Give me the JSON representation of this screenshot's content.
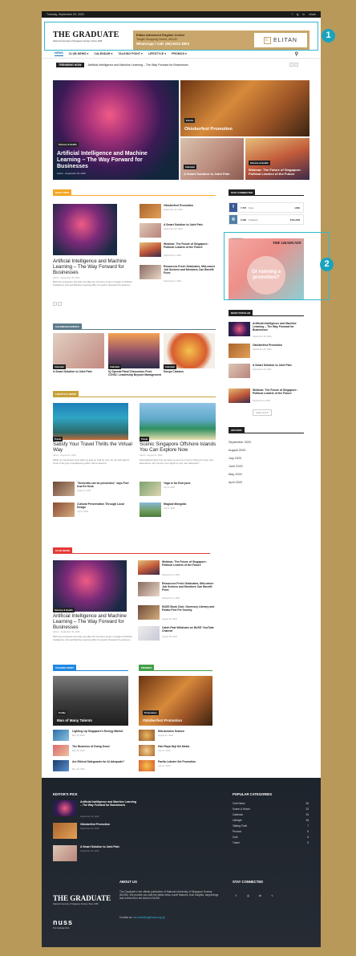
{
  "topbar": {
    "date": "Tuesday, September 29, 2020",
    "social": [
      "f",
      "ig",
      "in",
      "share"
    ]
  },
  "logo": {
    "title": "THE GRADUATE",
    "subtitle": "National University of Singapore Society  |  Since 1965"
  },
  "ad": {
    "line1": "Elitan Advanced English Centre",
    "line2": "Tanglin Shopping Centre, #04-82",
    "line3": "WhatsApp / Call: (65) 8223 3903",
    "brand": "ELITAN",
    "brand_sub": "E"
  },
  "badges": {
    "one": "1",
    "two": "2"
  },
  "nav": {
    "items": [
      "NEWS",
      "CLUB NEWS ▾",
      "CALENDAR ▾",
      "TALKING POINT ▾",
      "LIFESTYLE ▾",
      "PROMOS ▾"
    ]
  },
  "trending": {
    "label": "TRENDING NOW",
    "text": "Artificial Intelligence and Machine Learning – The Way Forward for Businesses"
  },
  "hero": {
    "big": {
      "tags": "Science & Health",
      "title": "Artificial Intelligence and Machine Learning – The Way Forward for Businesses",
      "meta": "Admin  -  September 30, 2020"
    },
    "top": {
      "tag": "Events",
      "title": "Oktoberfest Promotion"
    },
    "bl": {
      "tag": "Calendar",
      "title": "A Smart Solution to Joint Pain"
    },
    "br": {
      "tag": "Science & Health",
      "title": "Webinar: The Future of Singapore: Political Leaders of the Future"
    }
  },
  "dont_miss": {
    "label": "DON'T MISS",
    "main": {
      "title": "Artificial Intelligence and Machine Learning – The Way Forward for Businesses",
      "meta": "Admin  -  September 30, 2020",
      "text": "Both big companies and start-ups alike are immense scope of usage of Artificial Intelligence (AI) and Machine Learning (ML) for growth. Research by advisory..."
    },
    "list": [
      {
        "title": "Oktoberfest Promotion",
        "date": "September 29, 2020"
      },
      {
        "title": "A Smart Solution to Joint Pain",
        "date": "September 22, 2020"
      },
      {
        "title": "Webinar: The Future of Singapore: Political Leaders of the Future",
        "date": "September 9, 2020"
      },
      {
        "title": "Resources Fresh Graduates, Mid-career Job Seekers and Members Can Benefit From",
        "date": "September 3, 2020"
      }
    ]
  },
  "stay": {
    "label": "STAY CONNECTED",
    "fb": {
      "n": "7,797",
      "l": "Fans",
      "a": "LIKE"
    },
    "ig": {
      "n": "1,000",
      "l": "Followers",
      "a": "FOLLOW"
    }
  },
  "sidead": {
    "label": "Advertisement",
    "logo": "THE GRADUATE",
    "text": "Or running a promotion?"
  },
  "calendar": {
    "label": "CALENDAR EVENTS",
    "items": [
      {
        "tag": "Calendar",
        "title": "A Smart Solution to Joint Pain"
      },
      {
        "tag": "Calendar",
        "title": "IQ Special Panel Discussion Post-COVID: Leadership Beyond Management"
      },
      {
        "tag": "Calendar",
        "title": "Nonya Classics"
      }
    ]
  },
  "popular": {
    "label": "MOST POPULAR",
    "items": [
      {
        "title": "Artificial Intelligence and Machine Learning – The Way Forward for Businesses",
        "date": "September 30, 2020"
      },
      {
        "title": "Oktoberfest Promotion",
        "date": "September 29, 2020"
      },
      {
        "title": "A Smart Solution to Joint Pain",
        "date": "September 22, 2020"
      },
      {
        "title": "Webinar: The Future of Singapore: Political Leaders of the Future",
        "date": "September 9, 2020"
      }
    ],
    "load": "Load more ▾"
  },
  "archive": {
    "label": "ARCHIVE",
    "items": [
      "September 2020",
      "August 2020",
      "July 2020",
      "June 2020",
      "May 2020",
      "April 2020"
    ]
  },
  "lifestyle": {
    "label": "LIFESTYLE NEWS",
    "a": {
      "tag": "Travel",
      "title": "Satisfy Your Travel Thrills the Virtual Way",
      "meta": "Admin  -  August 24, 2020",
      "text": "While our wanderlust must sadly be kept on hold for now, we can still capture some of the joys of sightseeing online. We've assemb..."
    },
    "b": {
      "tag": "Travel",
      "title": "Scenic Singapore Offshore Islands You Can Explore Now",
      "meta": "Admin  -  August 14, 2020",
      "text": "International travel may not open up soon so if you're itching for some new adventures, why not turn your sights to your own backyard?..."
    },
    "list": [
      {
        "title": "\"Dementia can be prevented,\" says Prof Kua Ee Heok",
        "date": "August 6, 2020"
      },
      {
        "title": "Yoga is for Everyone",
        "date": "July 8, 2020"
      },
      {
        "title": "Cultural Preservation Through Local Design",
        "date": "July 8, 2020"
      },
      {
        "title": "Magical Mongolia",
        "date": "July 8, 2020"
      }
    ]
  },
  "club": {
    "label": "CLUB NEWS",
    "main": {
      "tag": "Science & Health",
      "title": "Artificial Intelligence and Machine Learning – The Way Forward for Businesses",
      "meta": "Admin  -  September 30, 2020",
      "text": "Both big companies and start-ups alike are immense scope of usage of Artificial Intelligence (AI) and Machine Learning (ML) for growth. Research by advisory..."
    },
    "list": [
      {
        "title": "Webinar: The Future of Singapore: Political Leaders of the Future",
        "date": "September 9, 2020"
      },
      {
        "title": "Resources Fresh Graduates, Mid-career Job Seekers and Members Can Benefit From",
        "date": "September 3, 2020"
      },
      {
        "title": "NUSS Book Club: Guernsey Literary and Potato Peel Pie Society",
        "date": "August 28, 2020"
      },
      {
        "title": "Catch Past Webinars on NUSS' YouTube Channel",
        "date": "August 18, 2020"
      }
    ]
  },
  "talking": {
    "label": "TALKING POINT",
    "main": {
      "tag": "Profile",
      "title": "Man of Many Talents"
    },
    "list": [
      {
        "title": "Lighting Up Singapore's Energy Market",
        "date": "May 18, 2020"
      },
      {
        "title": "The Business of Doing Good",
        "date": "May 18, 2020"
      },
      {
        "title": "Are Ethical Safeguards for AI Adequate?",
        "date": "May 18, 2020"
      }
    ]
  },
  "promos": {
    "label": "PROMOS",
    "main": {
      "tag": "Promotions",
      "title": "Oktoberfest Promotion"
    },
    "list": [
      {
        "title": "Mid-Autumn Season",
        "date": "August 31, 2020"
      },
      {
        "title": "Hari Raya Haji Set Meals",
        "date": "July 27, 2020"
      },
      {
        "title": "Paella Lobster Set Promotion",
        "date": "July 27, 2020"
      }
    ]
  },
  "footer": {
    "editor": {
      "label": "EDITOR'S PICK",
      "items": [
        {
          "title": "Artificial Intelligence and Machine Learning – The Way Forward for Businesses",
          "date": "September 30, 2020"
        },
        {
          "title": "Oktoberfest Promotion",
          "date": "September 29, 2020"
        },
        {
          "title": "A Smart Solution to Joint Pain",
          "date": "September 22, 2020"
        }
      ]
    },
    "cats": {
      "label": "POPULAR CATEGORIES",
      "items": [
        {
          "name": "Club News",
          "n": "26"
        },
        {
          "name": "Scene & Heard",
          "n": "23"
        },
        {
          "name": "Calendar",
          "n": "19"
        },
        {
          "name": "Lifestyle",
          "n": "18"
        },
        {
          "name": "Talking Point",
          "n": "7"
        },
        {
          "name": "Promos",
          "n": "6"
        },
        {
          "name": "Club",
          "n": "6"
        },
        {
          "name": "Travel",
          "n": "5"
        }
      ]
    },
    "about": {
      "label": "ABOUT US",
      "text": "The Graduate is the official publication of National University of Singapore Society (NUSS). We provide you with the latest news, travel features, tech insights, happenings and events from the world of NUSS.",
      "contact": "Contact us: ",
      "email": "ssc.marketing@nuss.org.sg"
    },
    "stay": {
      "label": "STAY CONNECTED"
    },
    "logo": "THE GRADUATE",
    "logo_sub": "National University of Singapore Society  |  Since 1965",
    "nuss": "nuss",
    "nuss_sub": "The Graduate Club"
  },
  "colors": {
    "accent": "#1673b7",
    "callout": "#34b6cf",
    "dont_miss": "#f5a623",
    "calendar": "#5d7b8a",
    "lifestyle": "#c8a13a",
    "club": "#e53935",
    "talking": "#1e88e5",
    "promos": "#43a047"
  }
}
